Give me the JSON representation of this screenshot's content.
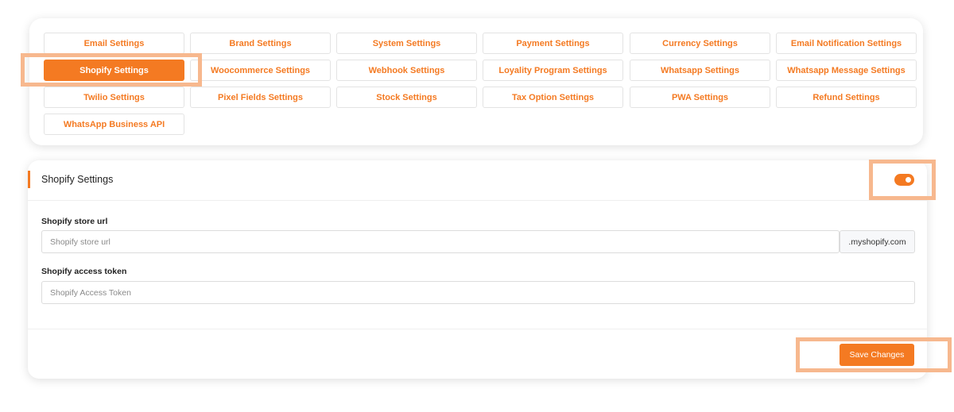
{
  "tabs": [
    [
      "Email Settings",
      "Brand Settings",
      "System Settings",
      "Payment Settings",
      "Currency Settings",
      "Email Notification Settings"
    ],
    [
      "Shopify Settings",
      "Woocommerce Settings",
      "Webhook Settings",
      "Loyality Program Settings",
      "Whatsapp Settings",
      "Whatsapp Message Settings"
    ],
    [
      "Twilio Settings",
      "Pixel Fields Settings",
      "Stock Settings",
      "Tax Option Settings",
      "PWA Settings",
      "Refund Settings"
    ],
    [
      "WhatsApp Business API"
    ]
  ],
  "active_tab": "Shopify Settings",
  "colors": {
    "accent": "#f47a22",
    "highlight": "#f7b88e"
  },
  "panel": {
    "title": "Shopify Settings",
    "toggle_enabled": true,
    "store_url": {
      "label": "Shopify store url",
      "placeholder": "Shopify store url",
      "value": "",
      "suffix": ".myshopify.com"
    },
    "access_token": {
      "label": "Shopify access token",
      "placeholder": "Shopify Access Token",
      "value": ""
    },
    "save_label": "Save Changes"
  }
}
